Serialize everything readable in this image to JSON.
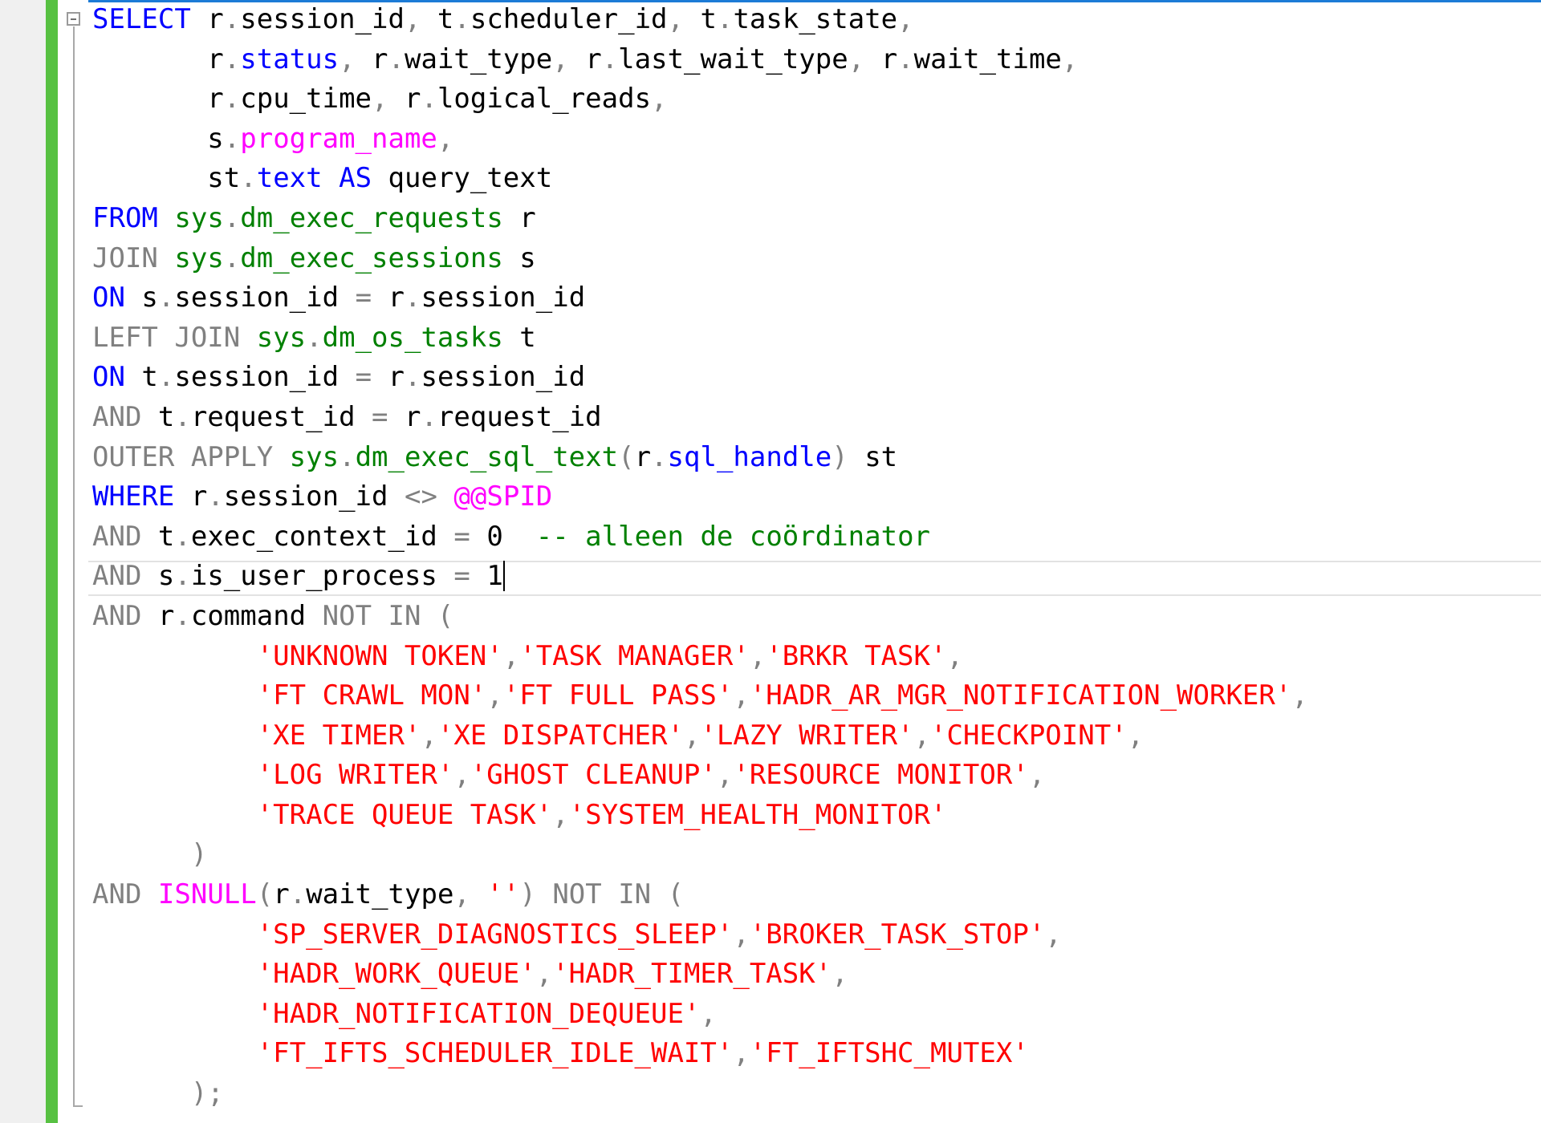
{
  "editor": {
    "colors": {
      "k": "#0000ff",
      "g": "#808080",
      "s": "#ff0000",
      "f": "#ff00ff",
      "o": "#008000",
      "c": "#008000",
      "t": "#000000",
      "change_bar": "#57c142"
    },
    "current_line_index": 14,
    "lines": [
      [
        [
          "k",
          "SELECT"
        ],
        [
          "t",
          " r"
        ],
        [
          "g",
          "."
        ],
        [
          "t",
          "session_id"
        ],
        [
          "g",
          ","
        ],
        [
          "t",
          " t"
        ],
        [
          "g",
          "."
        ],
        [
          "t",
          "scheduler_id"
        ],
        [
          "g",
          ","
        ],
        [
          "t",
          " t"
        ],
        [
          "g",
          "."
        ],
        [
          "t",
          "task_state"
        ],
        [
          "g",
          ","
        ]
      ],
      [
        [
          "t",
          "       r"
        ],
        [
          "g",
          "."
        ],
        [
          "k",
          "status"
        ],
        [
          "g",
          ","
        ],
        [
          "t",
          " r"
        ],
        [
          "g",
          "."
        ],
        [
          "t",
          "wait_type"
        ],
        [
          "g",
          ","
        ],
        [
          "t",
          " r"
        ],
        [
          "g",
          "."
        ],
        [
          "t",
          "last_wait_type"
        ],
        [
          "g",
          ","
        ],
        [
          "t",
          " r"
        ],
        [
          "g",
          "."
        ],
        [
          "t",
          "wait_time"
        ],
        [
          "g",
          ","
        ]
      ],
      [
        [
          "t",
          "       r"
        ],
        [
          "g",
          "."
        ],
        [
          "t",
          "cpu_time"
        ],
        [
          "g",
          ","
        ],
        [
          "t",
          " r"
        ],
        [
          "g",
          "."
        ],
        [
          "t",
          "logical_reads"
        ],
        [
          "g",
          ","
        ]
      ],
      [
        [
          "t",
          "       s"
        ],
        [
          "g",
          "."
        ],
        [
          "f",
          "program_name"
        ],
        [
          "g",
          ","
        ]
      ],
      [
        [
          "t",
          "       st"
        ],
        [
          "g",
          "."
        ],
        [
          "k",
          "text"
        ],
        [
          "t",
          " "
        ],
        [
          "k",
          "AS"
        ],
        [
          "t",
          " query_text"
        ]
      ],
      [
        [
          "k",
          "FROM"
        ],
        [
          "t",
          " "
        ],
        [
          "o",
          "sys"
        ],
        [
          "g",
          "."
        ],
        [
          "o",
          "dm_exec_requests"
        ],
        [
          "t",
          " r"
        ]
      ],
      [
        [
          "g",
          "JOIN"
        ],
        [
          "t",
          " "
        ],
        [
          "o",
          "sys"
        ],
        [
          "g",
          "."
        ],
        [
          "o",
          "dm_exec_sessions"
        ],
        [
          "t",
          " s"
        ]
      ],
      [
        [
          "k",
          "ON"
        ],
        [
          "t",
          " s"
        ],
        [
          "g",
          "."
        ],
        [
          "t",
          "session_id "
        ],
        [
          "g",
          "="
        ],
        [
          "t",
          " r"
        ],
        [
          "g",
          "."
        ],
        [
          "t",
          "session_id"
        ]
      ],
      [
        [
          "g",
          "LEFT JOIN"
        ],
        [
          "t",
          " "
        ],
        [
          "o",
          "sys"
        ],
        [
          "g",
          "."
        ],
        [
          "o",
          "dm_os_tasks"
        ],
        [
          "t",
          " t"
        ]
      ],
      [
        [
          "k",
          "ON"
        ],
        [
          "t",
          " t"
        ],
        [
          "g",
          "."
        ],
        [
          "t",
          "session_id "
        ],
        [
          "g",
          "="
        ],
        [
          "t",
          " r"
        ],
        [
          "g",
          "."
        ],
        [
          "t",
          "session_id"
        ]
      ],
      [
        [
          "g",
          "AND"
        ],
        [
          "t",
          " t"
        ],
        [
          "g",
          "."
        ],
        [
          "t",
          "request_id "
        ],
        [
          "g",
          "="
        ],
        [
          "t",
          " r"
        ],
        [
          "g",
          "."
        ],
        [
          "t",
          "request_id"
        ]
      ],
      [
        [
          "g",
          "OUTER APPLY"
        ],
        [
          "t",
          " "
        ],
        [
          "o",
          "sys"
        ],
        [
          "g",
          "."
        ],
        [
          "o",
          "dm_exec_sql_text"
        ],
        [
          "g",
          "("
        ],
        [
          "t",
          "r"
        ],
        [
          "g",
          "."
        ],
        [
          "k",
          "sql_handle"
        ],
        [
          "g",
          ")"
        ],
        [
          "t",
          " st"
        ]
      ],
      [
        [
          "k",
          "WHERE"
        ],
        [
          "t",
          " r"
        ],
        [
          "g",
          "."
        ],
        [
          "t",
          "session_id "
        ],
        [
          "g",
          "<>"
        ],
        [
          "t",
          " "
        ],
        [
          "f",
          "@@SPID"
        ]
      ],
      [
        [
          "g",
          "AND"
        ],
        [
          "t",
          " t"
        ],
        [
          "g",
          "."
        ],
        [
          "t",
          "exec_context_id "
        ],
        [
          "g",
          "="
        ],
        [
          "t",
          " 0  "
        ],
        [
          "c",
          "-- alleen de coördinator"
        ]
      ],
      [
        [
          "g",
          "AND"
        ],
        [
          "t",
          " s"
        ],
        [
          "g",
          "."
        ],
        [
          "t",
          "is_user_process "
        ],
        [
          "g",
          "="
        ],
        [
          "t",
          " 1"
        ]
      ],
      [
        [
          "g",
          "AND"
        ],
        [
          "t",
          " r"
        ],
        [
          "g",
          "."
        ],
        [
          "t",
          "command "
        ],
        [
          "g",
          "NOT IN ("
        ]
      ],
      [
        [
          "t",
          "          "
        ],
        [
          "s",
          "'UNKNOWN TOKEN'"
        ],
        [
          "g",
          ","
        ],
        [
          "s",
          "'TASK MANAGER'"
        ],
        [
          "g",
          ","
        ],
        [
          "s",
          "'BRKR TASK'"
        ],
        [
          "g",
          ","
        ]
      ],
      [
        [
          "t",
          "          "
        ],
        [
          "s",
          "'FT CRAWL MON'"
        ],
        [
          "g",
          ","
        ],
        [
          "s",
          "'FT FULL PASS'"
        ],
        [
          "g",
          ","
        ],
        [
          "s",
          "'HADR_AR_MGR_NOTIFICATION_WORKER'"
        ],
        [
          "g",
          ","
        ]
      ],
      [
        [
          "t",
          "          "
        ],
        [
          "s",
          "'XE TIMER'"
        ],
        [
          "g",
          ","
        ],
        [
          "s",
          "'XE DISPATCHER'"
        ],
        [
          "g",
          ","
        ],
        [
          "s",
          "'LAZY WRITER'"
        ],
        [
          "g",
          ","
        ],
        [
          "s",
          "'CHECKPOINT'"
        ],
        [
          "g",
          ","
        ]
      ],
      [
        [
          "t",
          "          "
        ],
        [
          "s",
          "'LOG WRITER'"
        ],
        [
          "g",
          ","
        ],
        [
          "s",
          "'GHOST CLEANUP'"
        ],
        [
          "g",
          ","
        ],
        [
          "s",
          "'RESOURCE MONITOR'"
        ],
        [
          "g",
          ","
        ]
      ],
      [
        [
          "t",
          "          "
        ],
        [
          "s",
          "'TRACE QUEUE TASK'"
        ],
        [
          "g",
          ","
        ],
        [
          "s",
          "'SYSTEM_HEALTH_MONITOR'"
        ]
      ],
      [
        [
          "t",
          "      "
        ],
        [
          "g",
          ")"
        ]
      ],
      [
        [
          "g",
          "AND"
        ],
        [
          "t",
          " "
        ],
        [
          "f",
          "ISNULL"
        ],
        [
          "g",
          "("
        ],
        [
          "t",
          "r"
        ],
        [
          "g",
          "."
        ],
        [
          "t",
          "wait_type"
        ],
        [
          "g",
          ","
        ],
        [
          "t",
          " "
        ],
        [
          "s",
          "''"
        ],
        [
          "g",
          ")"
        ],
        [
          "t",
          " "
        ],
        [
          "g",
          "NOT IN ("
        ]
      ],
      [
        [
          "t",
          "          "
        ],
        [
          "s",
          "'SP_SERVER_DIAGNOSTICS_SLEEP'"
        ],
        [
          "g",
          ","
        ],
        [
          "s",
          "'BROKER_TASK_STOP'"
        ],
        [
          "g",
          ","
        ]
      ],
      [
        [
          "t",
          "          "
        ],
        [
          "s",
          "'HADR_WORK_QUEUE'"
        ],
        [
          "g",
          ","
        ],
        [
          "s",
          "'HADR_TIMER_TASK'"
        ],
        [
          "g",
          ","
        ]
      ],
      [
        [
          "t",
          "          "
        ],
        [
          "s",
          "'HADR_NOTIFICATION_DEQUEUE'"
        ],
        [
          "g",
          ","
        ]
      ],
      [
        [
          "t",
          "          "
        ],
        [
          "s",
          "'FT_IFTS_SCHEDULER_IDLE_WAIT'"
        ],
        [
          "g",
          ","
        ],
        [
          "s",
          "'FT_IFTSHC_MUTEX'"
        ]
      ],
      [
        [
          "t",
          "      "
        ],
        [
          "g",
          ");"
        ]
      ]
    ]
  }
}
